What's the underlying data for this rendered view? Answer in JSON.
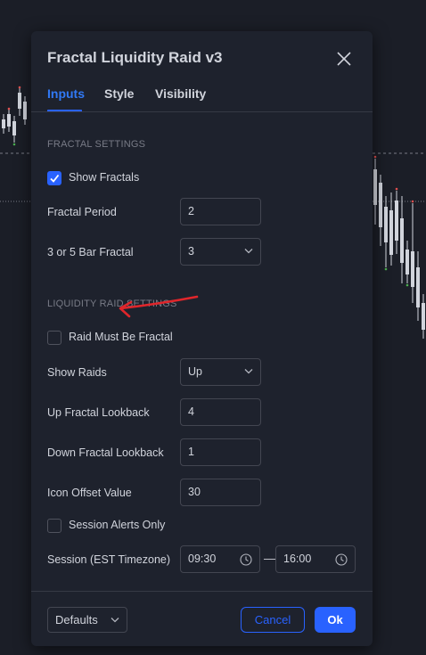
{
  "dialog": {
    "title": "Fractal Liquidity Raid v3",
    "tabs": [
      {
        "label": "Inputs",
        "active": true
      },
      {
        "label": "Style",
        "active": false
      },
      {
        "label": "Visibility",
        "active": false
      }
    ]
  },
  "fractal_settings": {
    "header": "FRACTAL SETTINGS",
    "show_fractals": {
      "label": "Show Fractals",
      "checked": true
    },
    "fractal_period": {
      "label": "Fractal Period",
      "value": "2"
    },
    "bar_fractal": {
      "label": "3 or 5 Bar Fractal",
      "value": "3"
    }
  },
  "liquidity_raid_settings": {
    "header": "LIQUIDITY RAID SETTINGS",
    "raid_must_be_fractal": {
      "label": "Raid Must Be Fractal",
      "checked": false
    },
    "show_raids": {
      "label": "Show Raids",
      "value": "Up"
    },
    "up_fractal_lookback": {
      "label": "Up Fractal Lookback",
      "value": "4"
    },
    "down_fractal_lookback": {
      "label": "Down Fractal Lookback",
      "value": "1"
    },
    "icon_offset_value": {
      "label": "Icon Offset Value",
      "value": "30"
    },
    "session_alerts_only": {
      "label": "Session Alerts Only",
      "checked": false
    },
    "session": {
      "label": "Session (EST Timezone)",
      "start": "09:30",
      "separator": "—",
      "end": "16:00"
    }
  },
  "footer": {
    "defaults_label": "Defaults",
    "cancel_label": "Cancel",
    "ok_label": "Ok"
  },
  "colors": {
    "accent": "#2962ff",
    "dialog_bg": "#1e222d",
    "annotation_arrow": "#e0262b"
  },
  "icons": {
    "close": "close-icon",
    "checkmark": "checkmark-icon",
    "chevron": "chevron-down-icon",
    "clock": "clock-icon"
  }
}
